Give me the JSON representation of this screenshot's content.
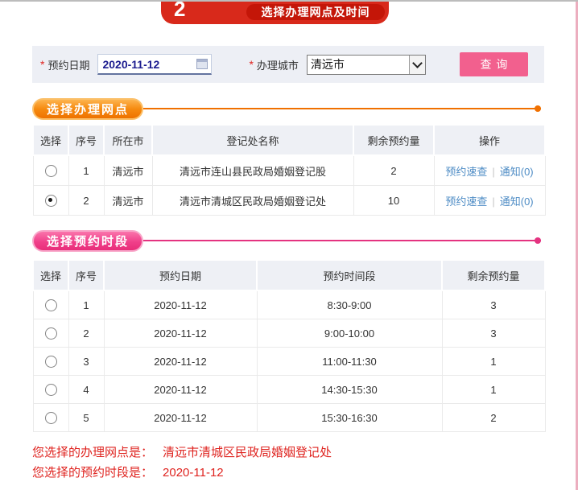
{
  "banner": {
    "step_number": "2",
    "title": "选择办理网点及时间"
  },
  "filter": {
    "required_mark": "*",
    "date_label": "预约日期",
    "date_value": "2020-11-12",
    "city_label": "办理城市",
    "city_value": "清远市",
    "query_button": "查询"
  },
  "site_section": {
    "title": "选择办理网点",
    "table": {
      "headers": [
        "选择",
        "序号",
        "所在市",
        "登记处名称",
        "剩余预约量",
        "操作"
      ],
      "rows": [
        {
          "selected": false,
          "index": "1",
          "city": "清远市",
          "name": "清远市连山县民政局婚姻登记股",
          "remaining": "2",
          "link_check": "预约速查",
          "link_notice": "通知(0)"
        },
        {
          "selected": true,
          "index": "2",
          "city": "清远市",
          "name": "清远市清城区民政局婚姻登记处",
          "remaining": "10",
          "link_check": "预约速查",
          "link_notice": "通知(0)"
        }
      ]
    }
  },
  "time_section": {
    "title": "选择预约时段",
    "table": {
      "headers": [
        "选择",
        "序号",
        "预约日期",
        "预约时间段",
        "剩余预约量"
      ],
      "rows": [
        {
          "selected": false,
          "index": "1",
          "date": "2020-11-12",
          "slot": "8:30-9:00",
          "remaining": "3"
        },
        {
          "selected": false,
          "index": "2",
          "date": "2020-11-12",
          "slot": "9:00-10:00",
          "remaining": "3"
        },
        {
          "selected": false,
          "index": "3",
          "date": "2020-11-12",
          "slot": "11:00-11:30",
          "remaining": "1"
        },
        {
          "selected": false,
          "index": "4",
          "date": "2020-11-12",
          "slot": "14:30-15:30",
          "remaining": "1"
        },
        {
          "selected": false,
          "index": "5",
          "date": "2020-11-12",
          "slot": "15:30-16:30",
          "remaining": "2"
        }
      ]
    }
  },
  "summary": {
    "site_label": "您选择的办理网点是：",
    "site_value": "清远市清城区民政局婚姻登记处",
    "time_label": "您选择的预约时段是：",
    "time_value": "2020-11-12"
  },
  "colors": {
    "banner_red": "#d8291b",
    "accent_orange": "#f07000",
    "accent_pink": "#e43380",
    "button_pink": "#f2608e",
    "link_blue": "#4e8cc5",
    "remaining_green": "#1ea21e",
    "summary_red": "#df2420"
  }
}
